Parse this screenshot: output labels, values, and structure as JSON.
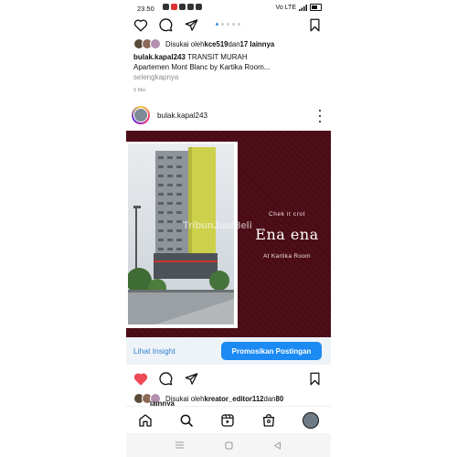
{
  "status_bar": {
    "time": "23.50",
    "signal_text": "Vo LTE",
    "icons": [
      "camera-icon",
      "notification-icon",
      "instagram-icon",
      "chat-icon",
      "clock-icon"
    ]
  },
  "post1": {
    "carousel_dots": 5,
    "liked_by_prefix": "Disukai oleh ",
    "liked_by_user": "kce519",
    "liked_by_conj": " dan ",
    "liked_by_rest": "17 lainnya",
    "caption_user": "bulak.kapal243",
    "caption_line1": " TRANSIT MURAH",
    "caption_line2": "Apartemen Mont Blanc by Kartika Room...",
    "more_label": "selengkapnya",
    "date": "9 Mei"
  },
  "post2": {
    "username": "bulak.kapal243",
    "image": {
      "small_text": "Chek it crot",
      "big_text": "Ena ena",
      "sub_text": "At Kartika Room",
      "watermark": "TribunJualBeli"
    },
    "insight_label": "Lihat Insight",
    "promote_label": "Promosikan Postingan",
    "liked_by_prefix": "Disukai oleh ",
    "liked_by_user": "kreator_editor112",
    "liked_by_conj": " dan ",
    "liked_by_rest": "80",
    "liked_overflow": "lainnya",
    "liked": true
  },
  "colors": {
    "accent": "#1b8af2",
    "link": "#2f7fd1",
    "heart": "#ed4956",
    "image_bg": "#4a0b16",
    "building_yellow": "#cdd04a"
  },
  "bottom_nav": [
    "home-icon",
    "search-icon",
    "reels-icon",
    "shop-icon",
    "profile-avatar"
  ],
  "system_nav": [
    "menu-icon",
    "home-square-icon",
    "back-icon"
  ]
}
